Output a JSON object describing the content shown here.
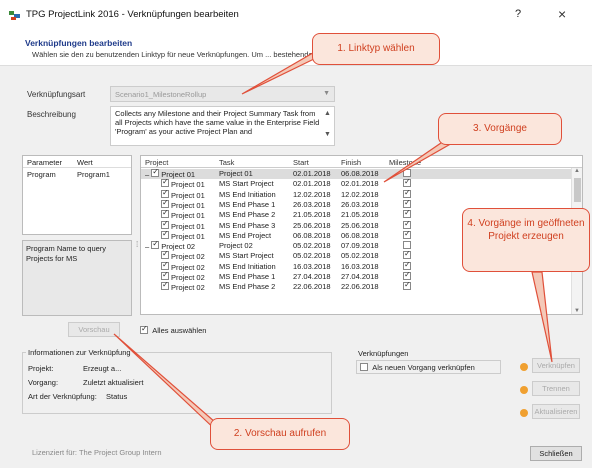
{
  "window": {
    "title": "TPG ProjectLink 2016 - Verknüpfungen bearbeiten",
    "help": "?",
    "close": "×"
  },
  "header": {
    "title": "Verknüpfungen bearbeiten",
    "description": "Wählen sie den zu benutzenden Linktyp für neue Verknüpfungen. Um ... bestehende zu verändern, muss"
  },
  "form": {
    "link_type_label": "Verknüpfungsart",
    "link_type_value": "Scenario1_MilestoneRollup",
    "description_label": "Beschreibung",
    "description_text": "Collects any Milestone and their Project Summary Task from all Projects which have the same value in the Enterprise Field 'Program' as your active Project Plan and"
  },
  "params": {
    "headers": [
      "Parameter",
      "Wert"
    ],
    "rows": [
      [
        "Program",
        "Program1"
      ]
    ],
    "info": "Program Name to query Projects for MS"
  },
  "grid": {
    "headers": [
      "Project",
      "Task",
      "Start",
      "Finish",
      "Milestone"
    ],
    "rows": [
      {
        "project": "Project 01",
        "task": "Project 01",
        "start": "02.01.2018",
        "finish": "06.08.2018",
        "ms": false,
        "group": true
      },
      {
        "project": "Project 01",
        "task": "MS Start Project",
        "start": "02.01.2018",
        "finish": "02.01.2018",
        "ms": true,
        "group": false
      },
      {
        "project": "Project 01",
        "task": "MS End Initiation",
        "start": "12.02.2018",
        "finish": "12.02.2018",
        "ms": true,
        "group": false
      },
      {
        "project": "Project 01",
        "task": "MS End Phase 1",
        "start": "26.03.2018",
        "finish": "26.03.2018",
        "ms": true,
        "group": false
      },
      {
        "project": "Project 01",
        "task": "MS End Phase 2",
        "start": "21.05.2018",
        "finish": "21.05.2018",
        "ms": true,
        "group": false
      },
      {
        "project": "Project 01",
        "task": "MS End Phase 3",
        "start": "25.06.2018",
        "finish": "25.06.2018",
        "ms": true,
        "group": false
      },
      {
        "project": "Project 01",
        "task": "MS End Project",
        "start": "06.08.2018",
        "finish": "06.08.2018",
        "ms": true,
        "group": false
      },
      {
        "project": "Project 02",
        "task": "Project 02",
        "start": "05.02.2018",
        "finish": "07.09.2018",
        "ms": false,
        "group": true
      },
      {
        "project": "Project 02",
        "task": "MS Start Project",
        "start": "05.02.2018",
        "finish": "05.02.2018",
        "ms": true,
        "group": false
      },
      {
        "project": "Project 02",
        "task": "MS End Initiation",
        "start": "16.03.2018",
        "finish": "16.03.2018",
        "ms": true,
        "group": false
      },
      {
        "project": "Project 02",
        "task": "MS End Phase 1",
        "start": "27.04.2018",
        "finish": "27.04.2018",
        "ms": true,
        "group": false
      },
      {
        "project": "Project 02",
        "task": "MS End Phase 2",
        "start": "22.06.2018",
        "finish": "22.06.2018",
        "ms": true,
        "group": false
      }
    ]
  },
  "preview_button": "Vorschau",
  "select_all_label": "Alles auswählen",
  "info_group": {
    "title": "Informationen zur Verknüpfung",
    "rows": [
      {
        "label": "Projekt:",
        "value": "Erzeugt a..."
      },
      {
        "label": "Vorgang:",
        "value": "Zuletzt aktualisiert"
      },
      {
        "label": "Art der Verknüpfung:",
        "value": "Status"
      }
    ]
  },
  "links_group": {
    "title": "Verknüpfungen",
    "new_task_label": "Als neuen Vorgang verknüpfen",
    "link_button": "Verknüpfen",
    "unlink_button": "Trennen",
    "refresh_button": "Aktualisieren"
  },
  "footer": {
    "license": "Lizenziert für: The Project Group Intern",
    "close_button": "Schließen"
  },
  "callouts": {
    "c1": "1. Linktyp wählen",
    "c2": "2. Vorschau aufrufen",
    "c3": "3. Vorgänge",
    "c4": "4. Vorgänge im geöffneten Projekt erzeugen"
  },
  "colors": {
    "callout_border": "#e0503a",
    "callout_fill": "#fbe6dc",
    "title_blue": "#1e3a8a"
  }
}
